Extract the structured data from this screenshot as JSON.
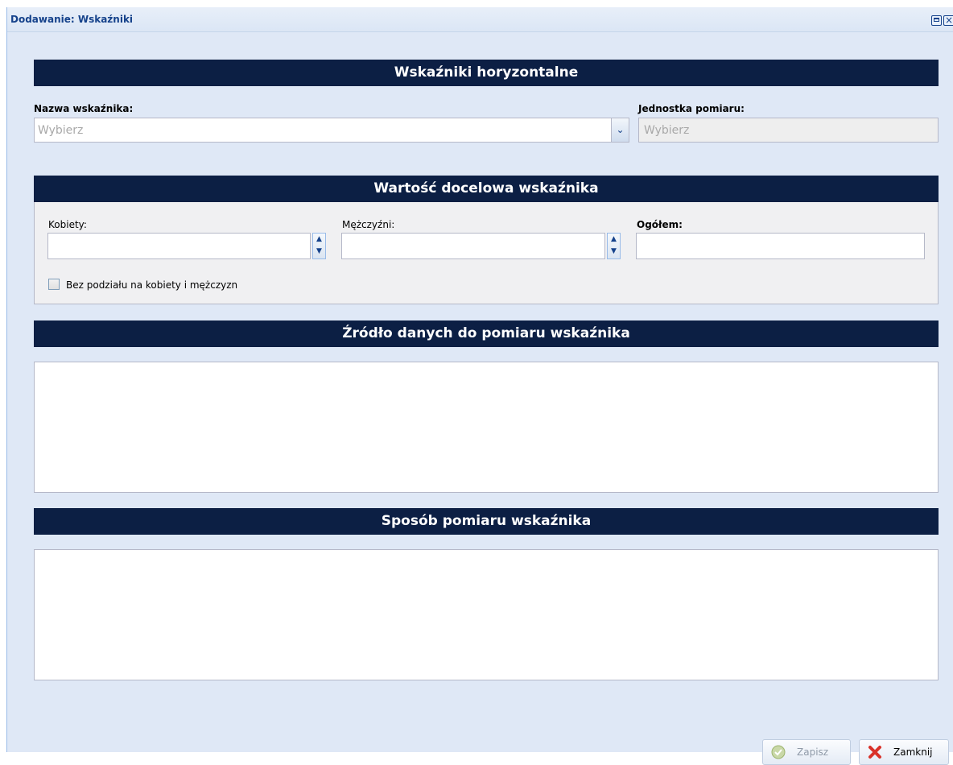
{
  "window": {
    "title": "Dodawanie: Wskaźniki"
  },
  "sections": {
    "horizontal": {
      "header": "Wskaźniki horyzontalne"
    },
    "target": {
      "header": "Wartość docelowa wskaźnika"
    },
    "source": {
      "header": "Źródło danych do pomiaru wskaźnika"
    },
    "method": {
      "header": "Sposób pomiaru wskaźnika"
    }
  },
  "indicator": {
    "name_label": "Nazwa wskaźnika:",
    "name_placeholder": "Wybierz",
    "unit_label": "Jednostka pomiaru:",
    "unit_placeholder": "Wybierz"
  },
  "target_value": {
    "women_label": "Kobiety:",
    "women_value": "",
    "men_label": "Mężczyźni:",
    "men_value": "",
    "total_label": "Ogółem:",
    "total_value": "",
    "no_split_label": "Bez podziału na kobiety i mężczyzn",
    "no_split_checked": false
  },
  "source_text": "",
  "method_text": "",
  "buttons": {
    "save_label": "Zapisz",
    "close_label": "Zamknij"
  },
  "icons": {
    "maximize": "maximize-icon",
    "close": "close-icon",
    "dropdown": "chevron-down-icon",
    "save": "check-circle-icon",
    "cancel": "red-x-icon"
  },
  "colors": {
    "section_header_bg": "#0c1f44",
    "window_bg": "#dfe8f6",
    "title_text": "#15428b"
  }
}
